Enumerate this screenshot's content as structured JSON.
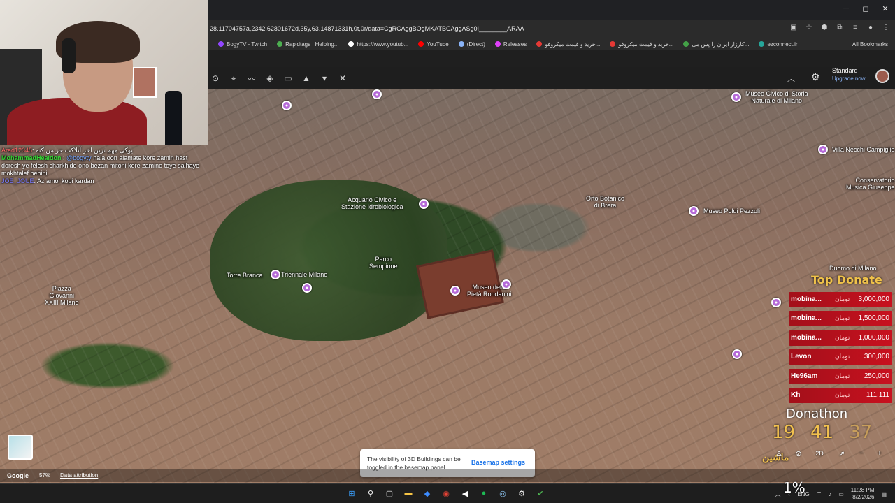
{
  "browser": {
    "url": "28.11704757a,2342.62801672d,35y,63.14871331h,0t,0r/data=CgRCAggBOgMKATBCAggASg0I________ARAA",
    "bookmarks": [
      {
        "label": "BogyTV - Twitch",
        "color": "#9146ff"
      },
      {
        "label": "Rapidtags | Helping...",
        "color": "#4caf50"
      },
      {
        "label": "https://www.youtub...",
        "color": "#ffffff"
      },
      {
        "label": "YouTube",
        "color": "#ff0000"
      },
      {
        "label": "(Direct)",
        "color": "#8ab4f8"
      },
      {
        "label": "Releases",
        "color": "#e040fb"
      },
      {
        "label": "خرید و قیمت میکروفو...",
        "color": "#e53935"
      },
      {
        "label": "خرید و قیمت میکروفو...",
        "color": "#e53935"
      },
      {
        "label": "کارزار ایران را پس می...",
        "color": "#43a047"
      },
      {
        "label": "ezconnect.ir",
        "color": "#26a69a"
      }
    ],
    "all_bookmarks": "All Bookmarks"
  },
  "earth": {
    "plan": "Standard",
    "upgrade": "Upgrade now"
  },
  "map_labels": [
    {
      "text": "Acquario Civico e\nStazione Idrobiologica",
      "cls": "lbl-acquario"
    },
    {
      "text": "Orto Botanico\ndi Brera",
      "cls": "lbl-orto"
    },
    {
      "text": "Museo Poldi Pezzoli",
      "cls": "lbl-poldi"
    },
    {
      "text": "Museo Civico di Storia\nNaturale di Milano",
      "cls": "lbl-storia"
    },
    {
      "text": "Villa Necchi Campiglio",
      "cls": "lbl-villa"
    },
    {
      "text": "Conservatorio\nMusica Giuseppe",
      "cls": "lbl-cons"
    },
    {
      "text": "Torre Branca",
      "cls": "lbl-torre"
    },
    {
      "text": "Triennale Milano",
      "cls": "lbl-triennale"
    },
    {
      "text": "Parco\nSempione",
      "cls": "lbl-parco"
    },
    {
      "text": "Museo della\nPietà Rondanini",
      "cls": "lbl-pieta"
    },
    {
      "text": "Piazza\nGiovanni\nXXIII Milano",
      "cls": "lbl-piazza"
    },
    {
      "text": "Duomo di Milano",
      "cls": "lbl-duomo"
    }
  ],
  "chat": [
    {
      "user": "Arad12345",
      "msg": ": یوکی مهم ترین اخر آنلاکت جز من کنه"
    },
    {
      "user": "MohammadHealdon",
      "mention": "@bogyty",
      "msg": " hala oon alamate kore zamin hast doresh ye felesh charkhide ono bezan mitoni kore zamino toye salhaye mokhtalef bebini"
    },
    {
      "user": "JOE_JOUE",
      "msg": ": Az amol kopi kardan"
    }
  ],
  "donations": {
    "title": "Top Donate",
    "currency": "تومان",
    "list": [
      {
        "name": "mobina...",
        "amount": "3,000,000"
      },
      {
        "name": "mobina...",
        "amount": "1,500,000"
      },
      {
        "name": "mobina...",
        "amount": "1,000,000"
      },
      {
        "name": "Levon",
        "amount": "300,000"
      },
      {
        "name": "He96am",
        "amount": "250,000"
      },
      {
        "name": "Kh",
        "amount": "111,111"
      }
    ],
    "donathon": "Donathon",
    "timer": [
      "19",
      "41",
      "37"
    ],
    "brand": "ماشین"
  },
  "map_ui": {
    "mode_2d": "2D",
    "tip_text": "The visibility of 3D Buildings can be toggled in the basemap panel.",
    "tip_button": "Basemap settings",
    "google": "Google",
    "loading": "57%",
    "attribution": "Data attribution"
  },
  "taskbar": {
    "lang": "ENG",
    "time": "11:28 PM",
    "date": "8/2/2026",
    "overlay_pct": "1%"
  }
}
